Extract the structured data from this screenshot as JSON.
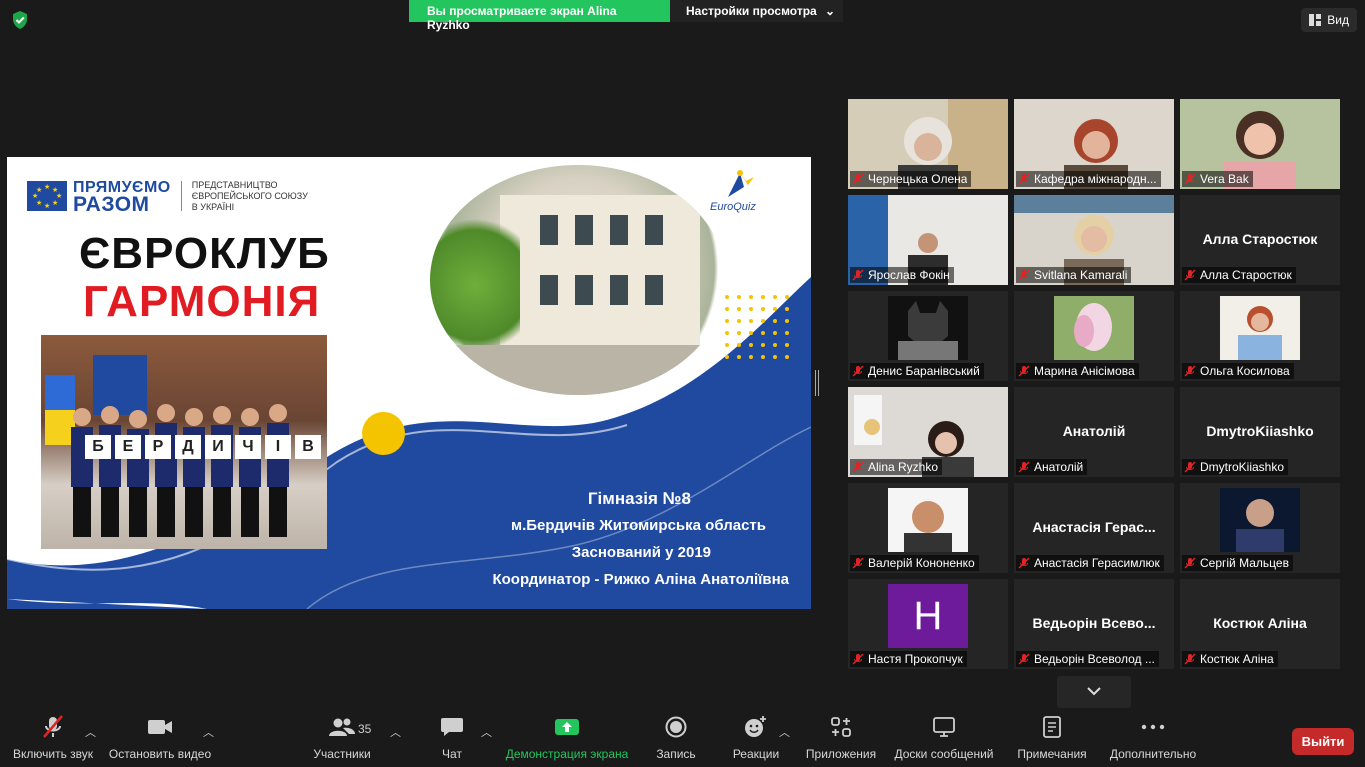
{
  "top_bar": {
    "sharing_banner": "Вы просматриваете экран Alina Ryzhko",
    "view_options": "Настройки просмотра",
    "view_button": "Вид"
  },
  "slide": {
    "logo_line1": "ПРЯМУЄМО",
    "logo_line2": "РАЗОМ",
    "logo_sub1": "ПРЕДСТАВНИЦТВО",
    "logo_sub2": "ЄВРОПЕЙСЬКОГО СОЮЗУ",
    "logo_sub3": "В УКРАЇНІ",
    "euroquiz": "EuroQuiz",
    "title_line1": "ЄВРОКЛУБ",
    "title_line2": "ГАРМОНІЯ",
    "photo_letters": [
      "Б",
      "Е",
      "Р",
      "Д",
      "И",
      "Ч",
      "І",
      "В"
    ],
    "info_line1": "Гімназія №8",
    "info_line2": "м.Бердичів Житомирська область",
    "info_line3": "Заснований у 2019",
    "info_line4": "Координатор - Рижко Аліна Анатоліївна",
    "colors": {
      "blue": "#1f4aa0",
      "red": "#e01b22",
      "sun": "#f5c400"
    }
  },
  "gallery": [
    {
      "name": "Чернецька Олена",
      "big": "",
      "video": "blonde"
    },
    {
      "name": "Кафедра міжнародн...",
      "big": "",
      "video": "redhair"
    },
    {
      "name": "Vera Bak",
      "big": "",
      "video": "darkhair"
    },
    {
      "name": "Ярослав Фокін",
      "big": "",
      "video": "man-room"
    },
    {
      "name": "Svitlana Kamarali",
      "big": "",
      "video": "woman-glasses"
    },
    {
      "name": "Алла Старостюк",
      "big": "Алла Старостюк",
      "video": "none"
    },
    {
      "name": "Денис Баранівський",
      "big": "",
      "video": "batman"
    },
    {
      "name": "Марина Анісімова",
      "big": "",
      "video": "magnolia"
    },
    {
      "name": "Ольга Косилова",
      "big": "",
      "video": "woman-portrait"
    },
    {
      "name": "Alina Ryzhko",
      "big": "",
      "video": "active-speaker"
    },
    {
      "name": "Анатолій",
      "big": "Анатолій",
      "video": "none"
    },
    {
      "name": "DmytroKiiashko",
      "big": "DmytroKiiashko",
      "video": "none"
    },
    {
      "name": "Валерій Кононенко",
      "big": "",
      "video": "man-portrait"
    },
    {
      "name": "Анастасія Герасимлюк",
      "big": "Анастасія Герас...",
      "video": "none"
    },
    {
      "name": "Сергій Мальцев",
      "big": "",
      "video": "man-suit"
    },
    {
      "name": "Настя Прокопчук",
      "big": "",
      "video": "letter-h",
      "initial": "H"
    },
    {
      "name": "Ведьорін Всеволод ...",
      "big": "Ведьорін Всево...",
      "video": "none"
    },
    {
      "name": "Костюк Аліна",
      "big": "Костюк Аліна",
      "video": "none"
    }
  ],
  "toolbar": {
    "unmute": "Включить звук",
    "stop_video": "Остановить видео",
    "participants": "Участники",
    "participants_count": "35",
    "chat": "Чат",
    "share_screen": "Демонстрация экрана",
    "record": "Запись",
    "reactions": "Реакции",
    "apps": "Приложения",
    "whiteboards": "Доски сообщений",
    "notes": "Примечания",
    "more": "Дополнительно",
    "leave": "Выйти"
  }
}
